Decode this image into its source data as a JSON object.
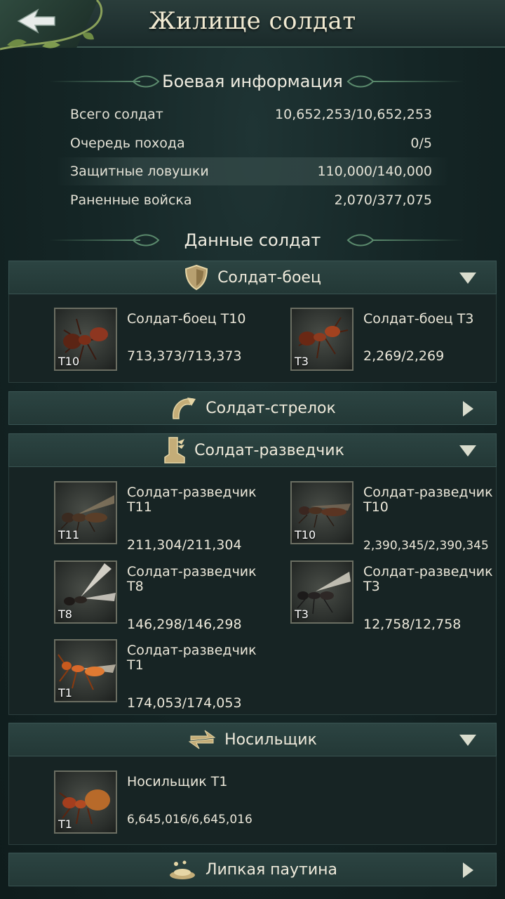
{
  "header": {
    "title": "Жилище солдат"
  },
  "battle_info": {
    "heading": "Боевая информация",
    "rows": [
      {
        "label": "Всего солдат",
        "value": "10,652,253/10,652,253"
      },
      {
        "label": "Очередь похода",
        "value": "0/5"
      },
      {
        "label": "Защитные ловушки",
        "value": "110,000/140,000"
      },
      {
        "label": "Раненные войска",
        "value": "2,070/377,075"
      }
    ]
  },
  "soldier_data": {
    "heading": "Данные солдат"
  },
  "categories": [
    {
      "label": "Солдат-боец",
      "icon": "shield-icon",
      "expanded": true,
      "units": [
        {
          "name": "Солдат-боец T10",
          "count": "713,373/713,373",
          "tier": "T10"
        },
        {
          "name": "Солдат-боец T3",
          "count": "2,269/2,269",
          "tier": "T3"
        }
      ]
    },
    {
      "label": "Солдат-стрелок",
      "icon": "bow-icon",
      "expanded": false,
      "units": []
    },
    {
      "label": "Солдат-разведчик",
      "icon": "boot-icon",
      "expanded": true,
      "units": [
        {
          "name": "Солдат-разведчик T11",
          "count": "211,304/211,304",
          "tier": "T11"
        },
        {
          "name": "Солдат-разведчик T10",
          "count": "2,390,345/2,390,345",
          "tier": "T10"
        },
        {
          "name": "Солдат-разведчик T8",
          "count": "146,298/146,298",
          "tier": "T8"
        },
        {
          "name": "Солдат-разведчик T3",
          "count": "12,758/12,758",
          "tier": "T3"
        },
        {
          "name": "Солдат-разведчик T1",
          "count": "174,053/174,053",
          "tier": "T1"
        }
      ]
    },
    {
      "label": "Носильщик",
      "icon": "transfer-arrows-icon",
      "expanded": true,
      "units": [
        {
          "name": "Носильщик T1",
          "count": "6,645,016/6,645,016",
          "tier": "T1"
        }
      ]
    },
    {
      "label": "Липкая паутина",
      "icon": "web-trap-icon",
      "expanded": false,
      "units": []
    }
  ],
  "colors": {
    "accent": "#c9a86a",
    "panel": "#172424",
    "bar": "#2c4442"
  }
}
